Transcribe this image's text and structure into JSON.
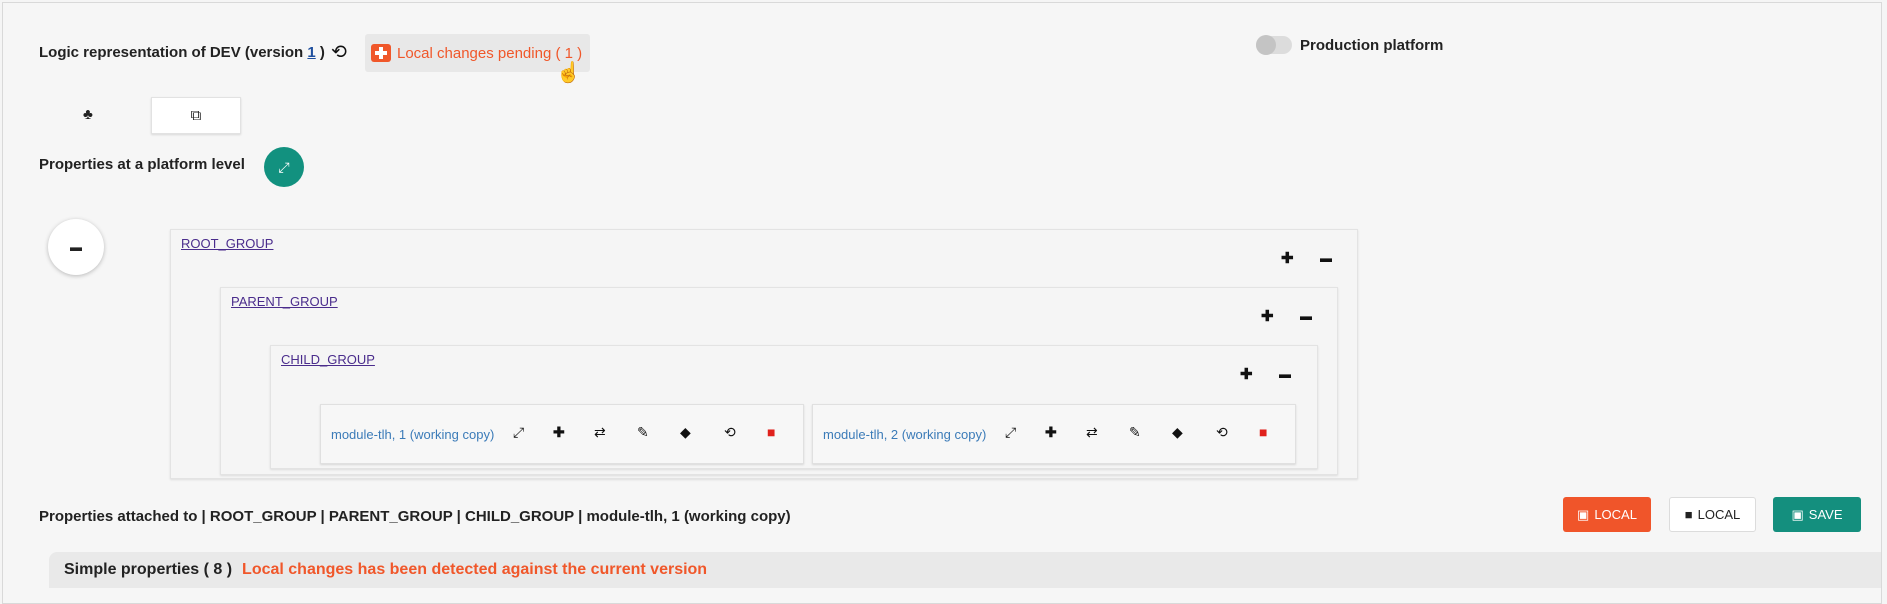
{
  "header": {
    "title_prefix": "Logic representation of DEV (version",
    "version": "1",
    "title_suffix": ")",
    "pending_label": "Local changes pending ( 1 )",
    "production_label": "Production platform",
    "production_enabled": false
  },
  "platform": {
    "properties_label": "Properties at a platform level"
  },
  "tree": {
    "groups": [
      "ROOT_GROUP",
      "PARENT_GROUP",
      "CHILD_GROUP"
    ],
    "modules": [
      {
        "name": "module-tlh, 1 (working copy)"
      },
      {
        "name": "module-tlh, 2 (working copy)"
      }
    ]
  },
  "attached": {
    "label": "Properties attached to | ROOT_GROUP | PARENT_GROUP | CHILD_GROUP | module-tlh, 1 (working copy)"
  },
  "actions": {
    "local_save_label": "LOCAL",
    "local_delete_label": "LOCAL",
    "save_label": "SAVE"
  },
  "simple_properties": {
    "label": "Simple properties ( 8 )",
    "warning": "Local changes has been detected against the current version"
  },
  "colors": {
    "accent_orange": "#f0572a",
    "accent_green": "#12917f",
    "link_purple": "#4a2c8c",
    "module_blue": "#3b7bb8",
    "delete_red": "#e0211c"
  },
  "icons": {
    "history": "history-icon",
    "medkit": "medkit-icon",
    "tree": "tree-icon",
    "copy": "copy-icon",
    "expand": "expand-icon",
    "inbox": "inbox-icon",
    "plus": "plus-icon",
    "swap": "swap-icon",
    "edit": "pencil-icon",
    "tag": "tag-icon",
    "trash": "trash-icon",
    "save": "floppy-icon"
  }
}
